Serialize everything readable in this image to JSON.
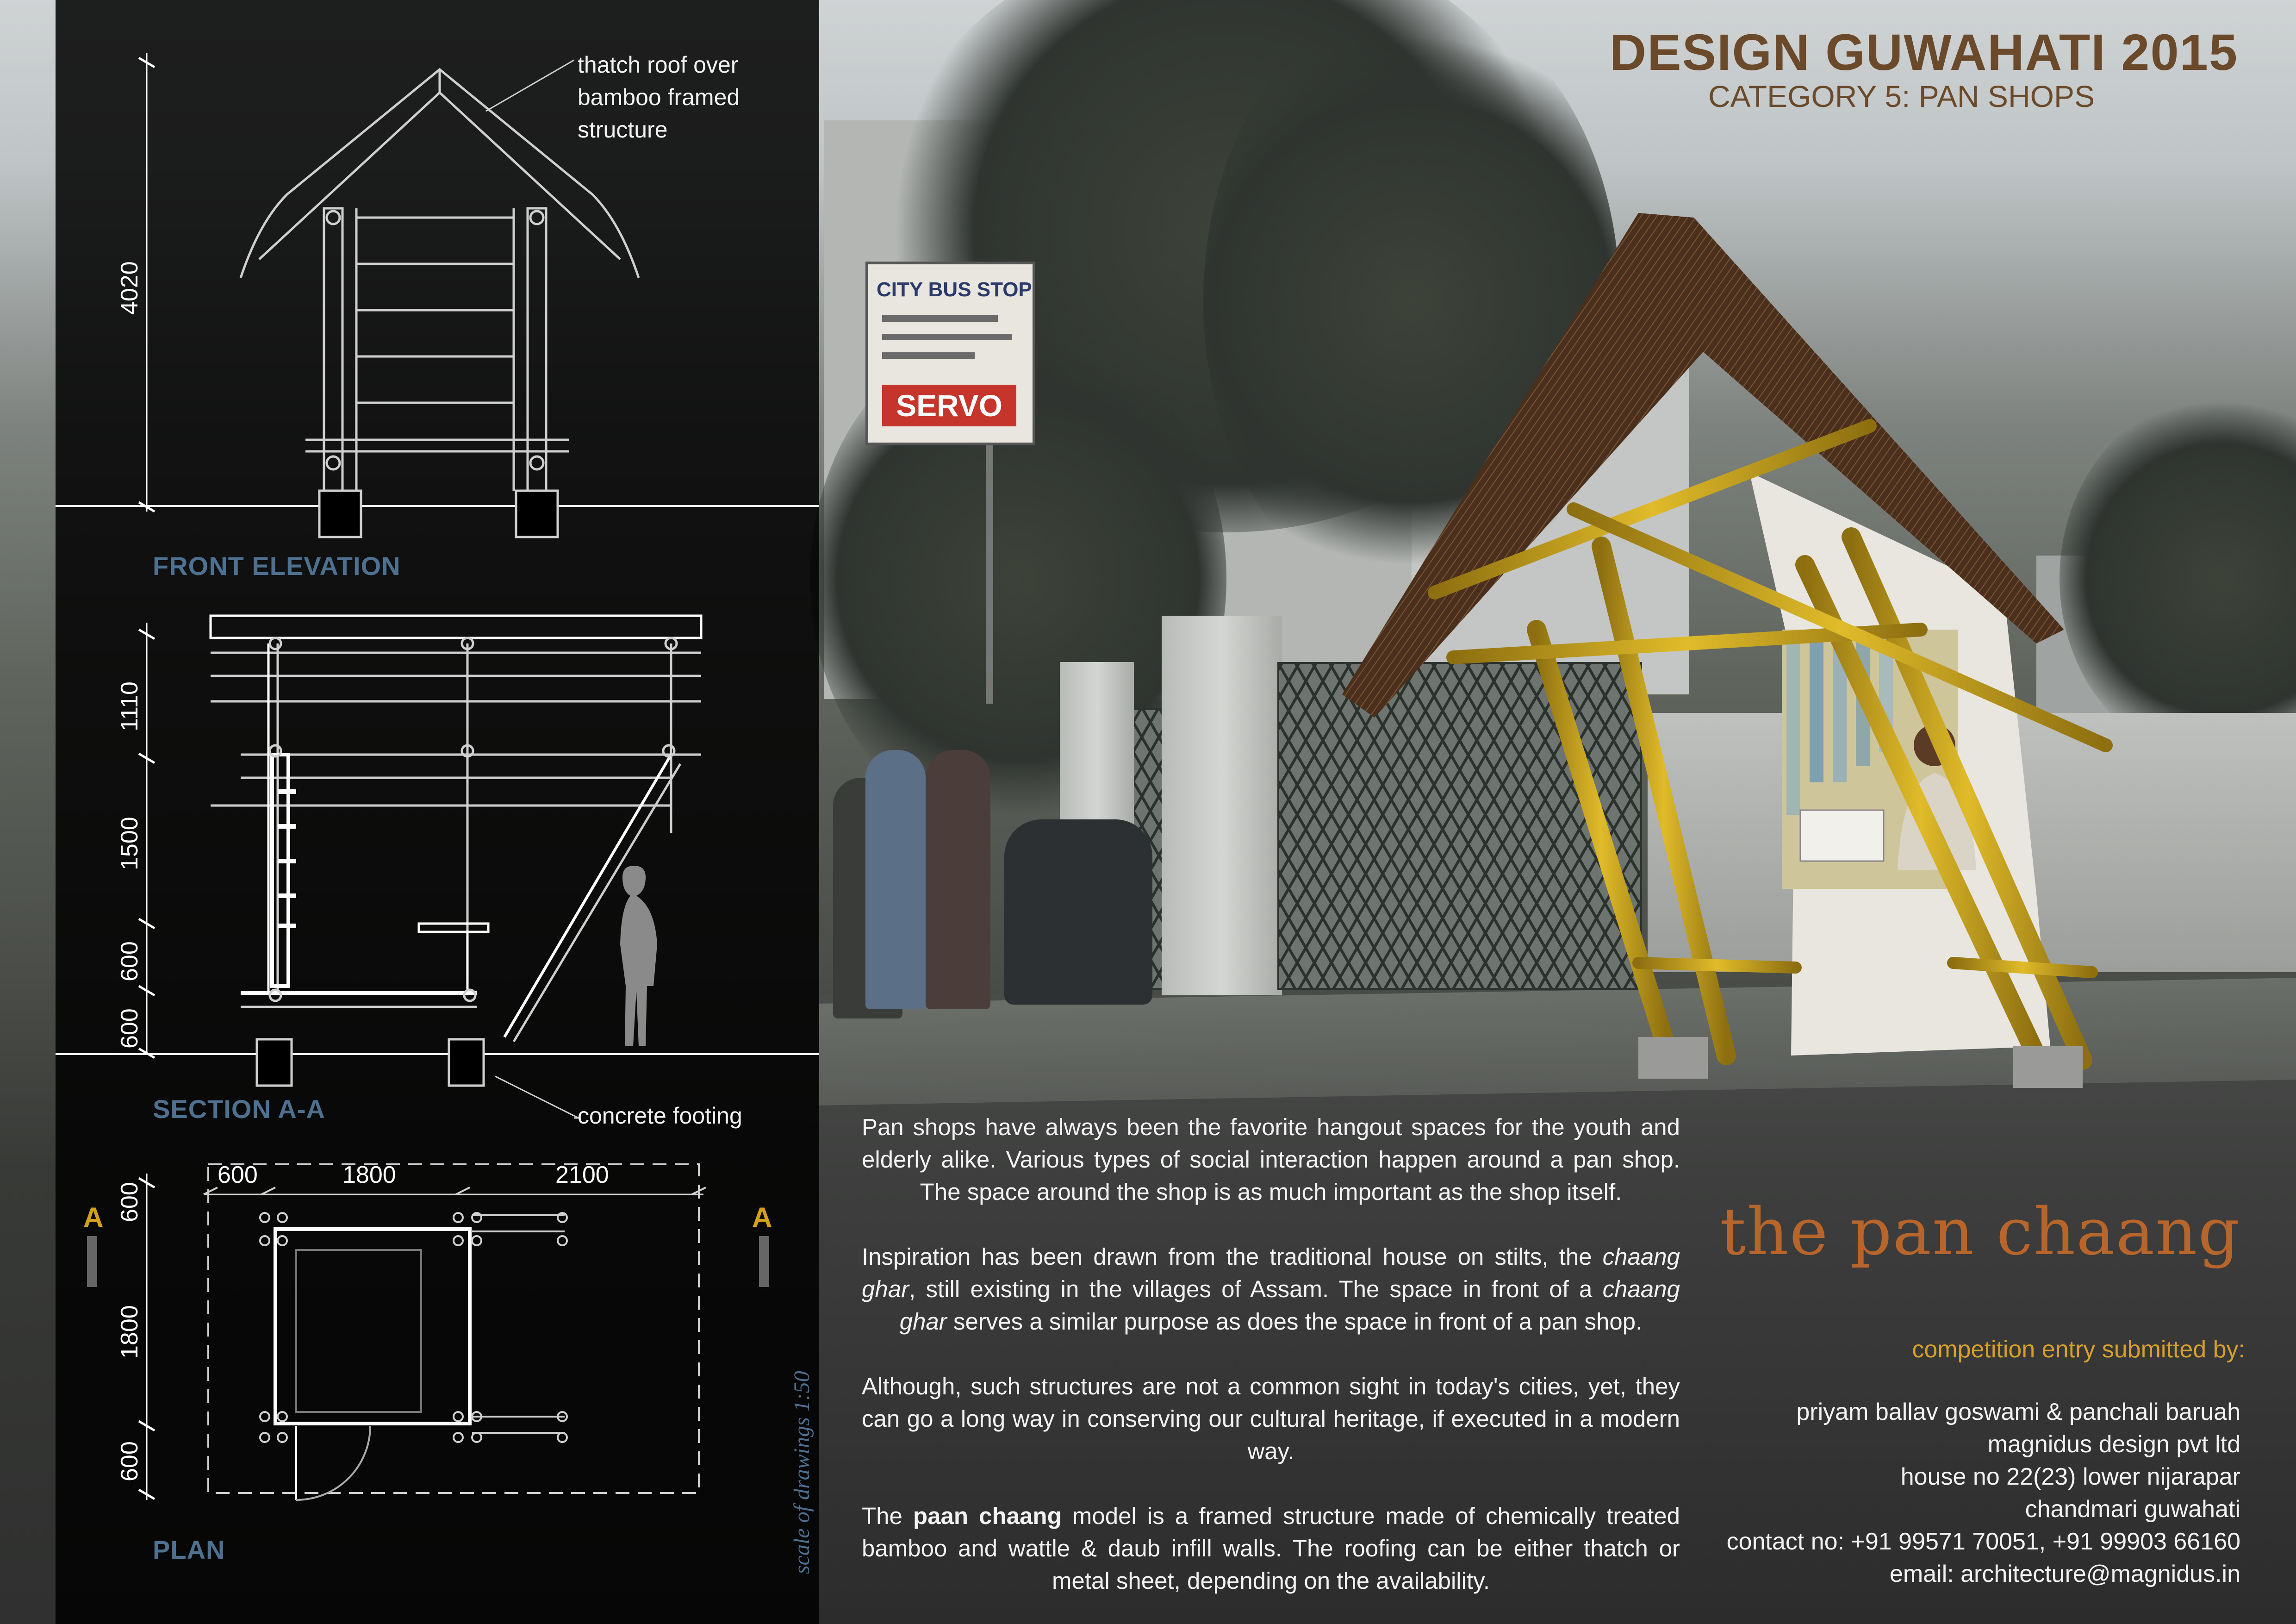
{
  "header": {
    "title": "DESIGN GUWAHATI 2015",
    "subtitle": "CATEGORY 5: PAN SHOPS"
  },
  "project_name": "the pan chaang",
  "photo": {
    "sign_line1": "CITY BUS STOP",
    "sign_line2": "SERVO"
  },
  "drawings": {
    "front_elevation": {
      "label": "FRONT ELEVATION",
      "note": [
        "thatch roof over",
        "bamboo framed",
        "structure"
      ],
      "dim_height": "4020"
    },
    "section": {
      "label": "SECTION A-A",
      "note": "concrete footing",
      "dims": [
        "1110",
        "1500",
        "600",
        "600"
      ]
    },
    "plan": {
      "label": "PLAN",
      "dims_top": [
        "600",
        "1800",
        "2100"
      ],
      "dims_side": [
        "600",
        "1800",
        "600"
      ],
      "section_mark_left": "A",
      "section_mark_right": "A"
    },
    "scale_note": "scale of drawings 1:50"
  },
  "description": {
    "p1": "Pan shops have always been the favorite hangout spaces for the youth and elderly alike. Various types of social interaction happen around a pan shop. The space around the shop is as much important as the shop itself.",
    "p2_a": "Inspiration has been drawn from the traditional house on stilts, the ",
    "p2_i1": "chaang ghar",
    "p2_b": ", still existing in the villages of Assam. The space in front of a ",
    "p2_i2": "chaang ghar",
    "p2_c": " serves a similar purpose as does the space in front of a pan shop.",
    "p3": "Although, such structures are not a common sight in today's cities, yet, they can go a long way in conserving our cultural heritage, if executed in a modern way.",
    "p4_a": "The ",
    "p4_b": "paan chaang",
    "p4_c": " model is a framed structure made of chemically treated bamboo and wattle & daub infill walls. The roofing can be either thatch or metal sheet, depending on the availability."
  },
  "submission": {
    "label": "competition entry submitted by:",
    "lines": [
      "priyam ballav goswami & panchali baruah",
      "magnidus design pvt ltd",
      "house no 22(23) lower nijarapar",
      "chandmari guwahati",
      "contact no: +91 99571 70051, +91 99903 66160",
      "email: architecture@magnidus.in"
    ]
  },
  "colors": {
    "title_brown": "#6a4a2a",
    "brand_orange": "#b8652c",
    "label_gold": "#d8a02a",
    "drawing_label_blue": "#4e7091",
    "bamboo_yellow": "#c9a21c"
  }
}
